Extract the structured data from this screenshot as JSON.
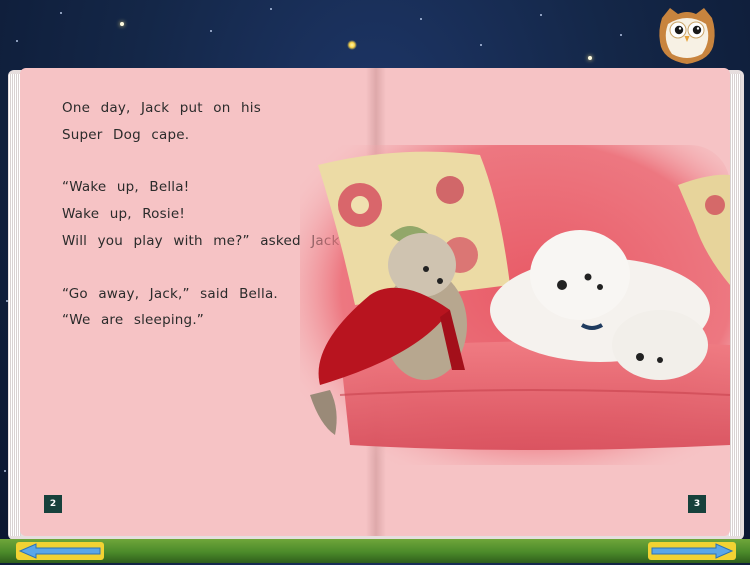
{
  "story": {
    "left_page": {
      "lines": [
        "One day, Jack put on his",
        "Super Dog cape.",
        "“Wake up, Bella!",
        "Wake up, Rosie!",
        "Will you play with me?” asked Jack.",
        "“Go away, Jack,” said Bella.",
        "“We are sleeping.”"
      ],
      "page_number": "2"
    },
    "right_page": {
      "page_number": "3"
    }
  },
  "icons": {
    "owl": "owl-icon",
    "back": "left-arrow-icon",
    "forward": "right-arrow-icon"
  },
  "colors": {
    "page": "#f6c3c5",
    "sky": "#142748",
    "page_number_bg": "#17413c",
    "nav_arrow": "#5aa6e8",
    "nav_bar": "#4b8a2a",
    "nav_button": "#f2d233"
  }
}
